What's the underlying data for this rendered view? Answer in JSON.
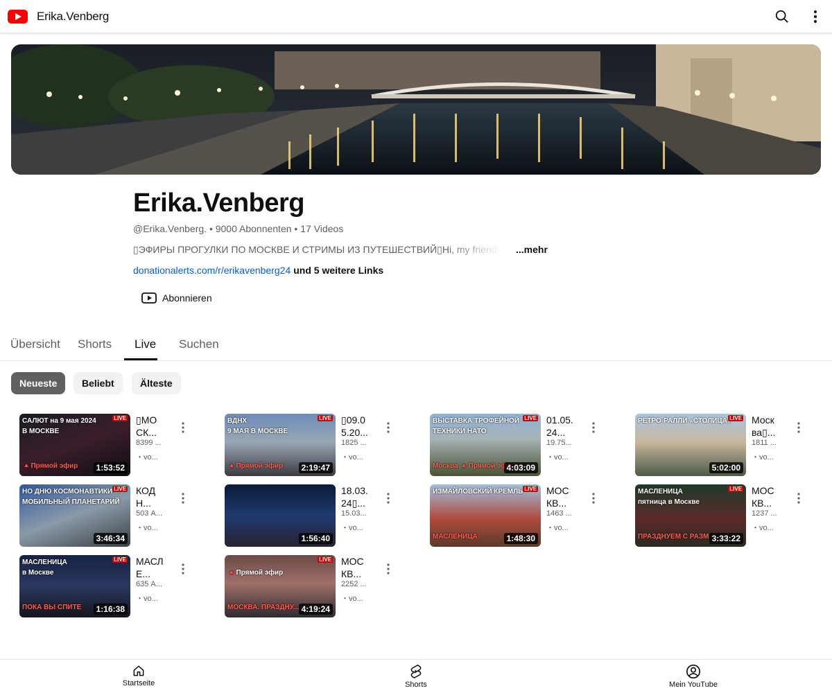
{
  "topbar": {
    "title": "Erika.Venberg"
  },
  "channel": {
    "name": "Erika.Venberg",
    "handle": "@Erika.Venberg.",
    "subscribers": "9000 Abonnenten",
    "videos": "17 Videos",
    "description": "▯ЭФИРЫ ПРОГУЛКИ ПО МОСКВЕ И СТРИМЫ ИЗ ПУТЕШЕСТВИЙ▯Hi, my friends",
    "more": "...mehr",
    "link": "donationalerts.com/r/erikavenberg24",
    "more_links": "und 5 weitere Links",
    "subscribe": "Abonnieren"
  },
  "tabs": [
    "Übersicht",
    "Shorts",
    "Live",
    "Suchen"
  ],
  "chips": [
    "Neueste",
    "Beliebt",
    "Älteste"
  ],
  "videos": [
    {
      "title": "▯МОСК...",
      "views": "8399 ...",
      "time": "・vo...",
      "duration": "1:53:52",
      "thumb_top": "САЛЮТ на 9 мая 2024",
      "thumb_mid": "В МОСКВЕ",
      "thumb_bottom": "🔺Прямой эфир",
      "live": "LIVE"
    },
    {
      "title": "▯09.05.20...",
      "views": "1825 ...",
      "time": "・vo...",
      "duration": "2:19:47",
      "thumb_top": "ВДНХ",
      "thumb_mid": "9 МАЯ В МОСКВЕ",
      "thumb_bottom": "🔺Прямой эфир",
      "live": "LIVE"
    },
    {
      "title": "01.05.24...",
      "views": "19.75...",
      "time": "・vo...",
      "duration": "4:03:09",
      "thumb_top": "ВЫСТАВКА ТРОФЕЙНОЙ",
      "thumb_mid": "ТЕХНИКИ НАТО",
      "thumb_bottom": "Москва 🔺Прямой эфир",
      "live": "LIVE"
    },
    {
      "title": "Москва▯...",
      "views": "1811 ...",
      "time": "・vo...",
      "duration": "5:02:00",
      "thumb_top": "РЕТРО-РАЛЛИ «СТОЛИЦА»",
      "thumb_mid": "",
      "thumb_bottom": "",
      "live": "LIVE"
    },
    {
      "title": "КОДН...",
      "views": "503 А...",
      "time": "・vo...",
      "duration": "3:46:34",
      "thumb_top": "НО ДНЮ КОСМОНАВТИКИ",
      "thumb_mid": "МОБИЛЬНЫЙ ПЛАНЕТАРИЙ",
      "thumb_bottom": "",
      "live": "LIVE"
    },
    {
      "title": "18.03.24▯...",
      "views": "15.03...",
      "time": "・vo...",
      "duration": "1:56:40",
      "thumb_top": "",
      "thumb_mid": "",
      "thumb_bottom": "",
      "live": ""
    },
    {
      "title": "МОСКВ...",
      "views": "1463 ...",
      "time": "・vo...",
      "duration": "1:48:30",
      "thumb_top": "ИЗМАЙЛОВСКИЙ КРЕМЛЬ",
      "thumb_mid": "",
      "thumb_bottom": "МАСЛЕНИЦА",
      "live": "LIVE"
    },
    {
      "title": "МОСКВ...",
      "views": "1237 ...",
      "time": "・vo...",
      "duration": "3:33:22",
      "thumb_top": "МАСЛЕНИЦА",
      "thumb_mid": "пятница в Москве",
      "thumb_bottom": "ПРАЗДНУЕМ С РАЗМ...",
      "live": "LIVE"
    },
    {
      "title": "МАСЛЕ...",
      "views": "635 А...",
      "time": "・vo...",
      "duration": "1:16:38",
      "thumb_top": "МАСЛЕНИЦА",
      "thumb_mid": "в Москве",
      "thumb_bottom": "ПОКА ВЫ СПИТЕ",
      "live": "LIVE"
    },
    {
      "title": "МОСКВ...",
      "views": "2252 ...",
      "time": "・vo...",
      "duration": "4:19:24",
      "thumb_top": "",
      "thumb_mid": "🔺Прямой эфир",
      "thumb_bottom": "МОСКВА. ПРАЗДНУ...",
      "live": "LIVE"
    }
  ],
  "bottom_nav": [
    "Startseite",
    "Shorts",
    "Mein YouTube"
  ]
}
